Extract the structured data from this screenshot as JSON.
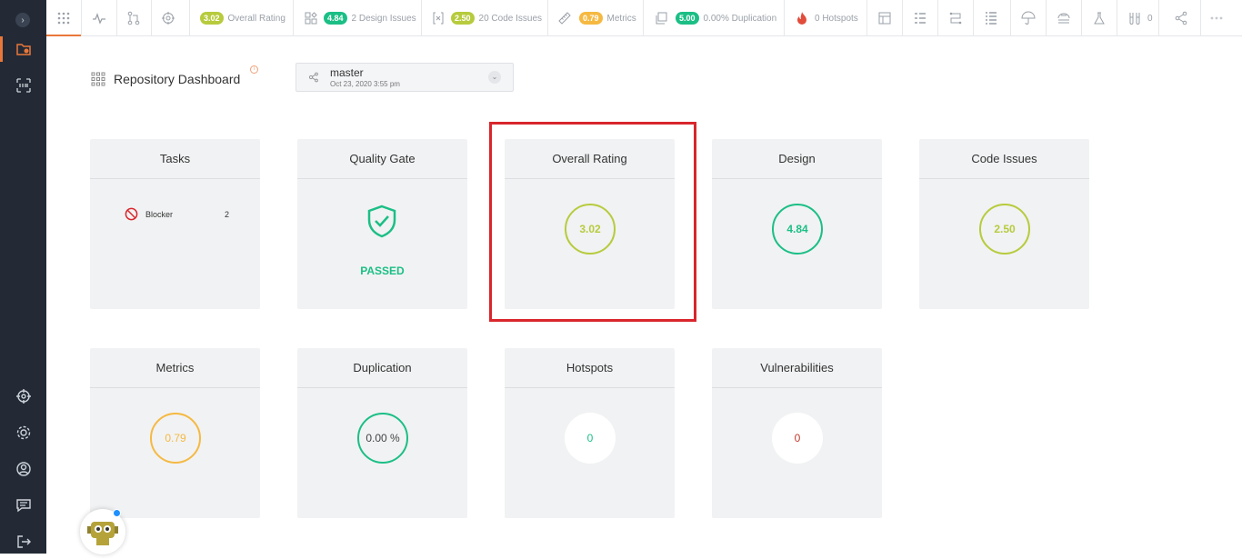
{
  "topbar": {
    "overall_rating": {
      "value": "3.02",
      "label": "Overall Rating",
      "color": "#b7cb3d"
    },
    "design": {
      "value": "4.84",
      "label": "2 Design Issues",
      "color": "#1bbf86"
    },
    "code": {
      "value": "2.50",
      "label": "20 Code Issues",
      "color": "#b7cb3d"
    },
    "metrics": {
      "value": "0.79",
      "label": "Metrics",
      "color": "#f5b942"
    },
    "duplication": {
      "value": "5.00",
      "label": "0.00% Duplication",
      "color": "#1bbf86"
    },
    "hotspots": {
      "label": "0 Hotspots"
    },
    "tests_count": "0"
  },
  "header": {
    "title": "Repository Dashboard",
    "info": "i",
    "branch": "master",
    "branch_date": "Oct 23, 2020    3:55 pm"
  },
  "cards": {
    "tasks": {
      "title": "Tasks",
      "blocker_label": "Blocker",
      "blocker_count": "2"
    },
    "quality_gate": {
      "title": "Quality Gate",
      "status": "PASSED"
    },
    "overall_rating": {
      "title": "Overall Rating",
      "value": "3.02",
      "color": "#b7cb3d"
    },
    "design": {
      "title": "Design",
      "value": "4.84",
      "color": "#1bbf86"
    },
    "code_issues": {
      "title": "Code Issues",
      "value": "2.50",
      "color": "#b7cb3d"
    },
    "metrics": {
      "title": "Metrics",
      "value": "0.79",
      "color": "#f5b942"
    },
    "duplication": {
      "title": "Duplication",
      "value": "0.00 %",
      "color": "#1bbf86"
    },
    "hotspots": {
      "title": "Hotspots",
      "value": "0",
      "color": "#1bbf86"
    },
    "vulnerabilities": {
      "title": "Vulnerabilities",
      "value": "0",
      "color": "#c0392b"
    }
  },
  "colors": {
    "accent": "#e9773a",
    "sidebar": "#232a36",
    "highlight": "#d9262c"
  }
}
